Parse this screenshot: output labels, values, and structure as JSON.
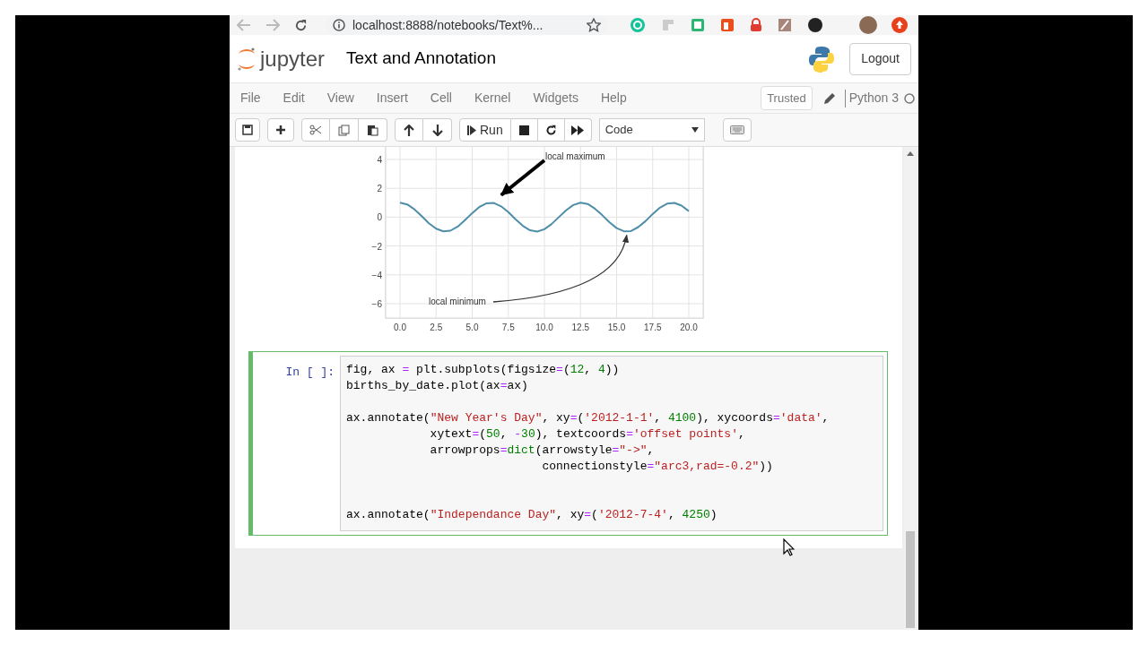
{
  "browser": {
    "url": "localhost:8888/notebooks/Text%..."
  },
  "header": {
    "logo_text": "jupyter",
    "notebook_title": "Text and Annotation",
    "logout": "Logout"
  },
  "menu": [
    "File",
    "Edit",
    "View",
    "Insert",
    "Cell",
    "Kernel",
    "Widgets",
    "Help"
  ],
  "kernel": {
    "trusted": "Trusted",
    "name": "Python 3"
  },
  "toolbar": {
    "run_label": "Run",
    "cell_type": "Code"
  },
  "output": {
    "chart_data": {
      "type": "line",
      "x": [
        0,
        0.5,
        1,
        1.5,
        2,
        2.5,
        3,
        3.5,
        4,
        4.5,
        5,
        5.5,
        6,
        6.5,
        7,
        7.5,
        8,
        8.5,
        9,
        9.5,
        10,
        10.5,
        11,
        11.5,
        12,
        12.5,
        13,
        13.5,
        14,
        14.5,
        15,
        15.5,
        16,
        16.5,
        17,
        17.5,
        18,
        18.5,
        19,
        19.5,
        20
      ],
      "series": [
        {
          "color": "#4f8ea8",
          "values": [
            1,
            0.88,
            0.54,
            0.07,
            -0.42,
            -0.8,
            -0.99,
            -0.94,
            -0.65,
            -0.21,
            0.28,
            0.71,
            0.96,
            0.98,
            0.75,
            0.35,
            -0.15,
            -0.6,
            -0.91,
            -1,
            -0.84,
            -0.48,
            0,
            0.48,
            0.84,
            1,
            0.91,
            0.59,
            0.14,
            -0.35,
            -0.76,
            -0.98,
            -0.96,
            -0.69,
            -0.28,
            0.22,
            0.66,
            0.94,
            0.99,
            0.8,
            0.41
          ]
        }
      ],
      "xlim": [
        -1,
        21
      ],
      "ylim": [
        -7,
        5
      ],
      "grid": true,
      "xticks": [
        {
          "value": 0,
          "label": "0.0"
        },
        {
          "value": 2.5,
          "label": "2.5"
        },
        {
          "value": 5,
          "label": "5.0"
        },
        {
          "value": 7.5,
          "label": "7.5"
        },
        {
          "value": 10,
          "label": "10.0"
        },
        {
          "value": 12.5,
          "label": "12.5"
        },
        {
          "value": 15,
          "label": "15.0"
        },
        {
          "value": 17.5,
          "label": "17.5"
        },
        {
          "value": 20,
          "label": "20.0"
        }
      ],
      "yticks": [
        -6,
        -4,
        -2,
        0,
        2,
        4
      ],
      "annotations": [
        "local maximum",
        {
          "text": "local minimum",
          "x": 15.7,
          "y": -1
        }
      ]
    }
  },
  "cell": {
    "prompt": "In [ ]:",
    "selected": true,
    "lines": [
      {
        "tokens": [
          {
            "text": "fig, ax ",
            "kind": "plain"
          },
          {
            "text": "=",
            "kind": "op"
          },
          {
            "text": " plt.subplots(figsize",
            "kind": "plain"
          },
          {
            "text": "=",
            "kind": "op"
          },
          {
            "text": "(",
            "kind": "plain"
          },
          {
            "text": "12",
            "kind": "number"
          },
          {
            "text": ", ",
            "kind": "plain"
          },
          {
            "text": "4",
            "kind": "number"
          },
          {
            "text": "))",
            "kind": "plain"
          }
        ]
      },
      {
        "tokens": [
          {
            "text": "births_by_date.plot(ax",
            "kind": "plain"
          },
          {
            "text": "=",
            "kind": "op"
          },
          {
            "text": "ax)",
            "kind": "plain"
          }
        ]
      },
      {
        "kind": "blank"
      },
      {
        "tokens": [
          {
            "text": "ax.annotate(",
            "kind": "plain"
          },
          {
            "text": "\"New Year's Day\"",
            "kind": "string"
          },
          {
            "text": ", xy",
            "kind": "plain"
          },
          {
            "text": "=",
            "kind": "op"
          },
          {
            "text": "(",
            "kind": "plain"
          },
          {
            "text": "'2012-1-1'",
            "kind": "string"
          },
          {
            "text": ", ",
            "kind": "plain"
          },
          {
            "text": "4100",
            "kind": "number"
          },
          {
            "text": "), xycoords",
            "kind": "plain"
          },
          {
            "text": "=",
            "kind": "op"
          },
          {
            "text": "'data'",
            "kind": "string"
          },
          {
            "text": ",",
            "kind": "plain"
          }
        ]
      },
      {
        "tokens": [
          {
            "text": "            xytext",
            "kind": "plain"
          },
          {
            "text": "=",
            "kind": "op"
          },
          {
            "text": "(",
            "kind": "plain"
          },
          {
            "text": "50",
            "kind": "number"
          },
          {
            "text": ", ",
            "kind": "plain"
          },
          {
            "text": "-",
            "kind": "op"
          },
          {
            "text": "30",
            "kind": "number"
          },
          {
            "text": "), textcoords",
            "kind": "plain"
          },
          {
            "text": "=",
            "kind": "op"
          },
          {
            "text": "'offset points'",
            "kind": "string"
          },
          {
            "text": ",",
            "kind": "plain"
          }
        ]
      },
      {
        "tokens": [
          {
            "text": "            arrowprops",
            "kind": "plain"
          },
          {
            "text": "=",
            "kind": "op"
          },
          {
            "text": "dict",
            "kind": "builtin"
          },
          {
            "text": "(arrowstyle",
            "kind": "plain"
          },
          {
            "text": "=",
            "kind": "op"
          },
          {
            "text": "\"->\"",
            "kind": "string"
          },
          {
            "text": ",",
            "kind": "plain"
          }
        ]
      },
      {
        "tokens": [
          {
            "text": "                            connectionstyle",
            "kind": "plain"
          },
          {
            "text": "=",
            "kind": "op"
          },
          {
            "text": "\"arc3,rad=-0.2\"",
            "kind": "string"
          },
          {
            "text": "))",
            "kind": "plain"
          }
        ]
      },
      {
        "kind": "blank"
      },
      {
        "kind": "blank"
      },
      {
        "tokens": [
          {
            "text": "ax.annotate(",
            "kind": "plain"
          },
          {
            "text": "\"Independance Day\"",
            "kind": "string"
          },
          {
            "text": ", xy",
            "kind": "plain"
          },
          {
            "text": "=",
            "kind": "op"
          },
          {
            "text": "(",
            "kind": "plain"
          },
          {
            "text": "'2012-7-4'",
            "kind": "string"
          },
          {
            "text": ", ",
            "kind": "plain"
          },
          {
            "text": "4250",
            "kind": "number"
          },
          {
            "text": ")",
            "kind": "plain"
          }
        ]
      }
    ]
  }
}
